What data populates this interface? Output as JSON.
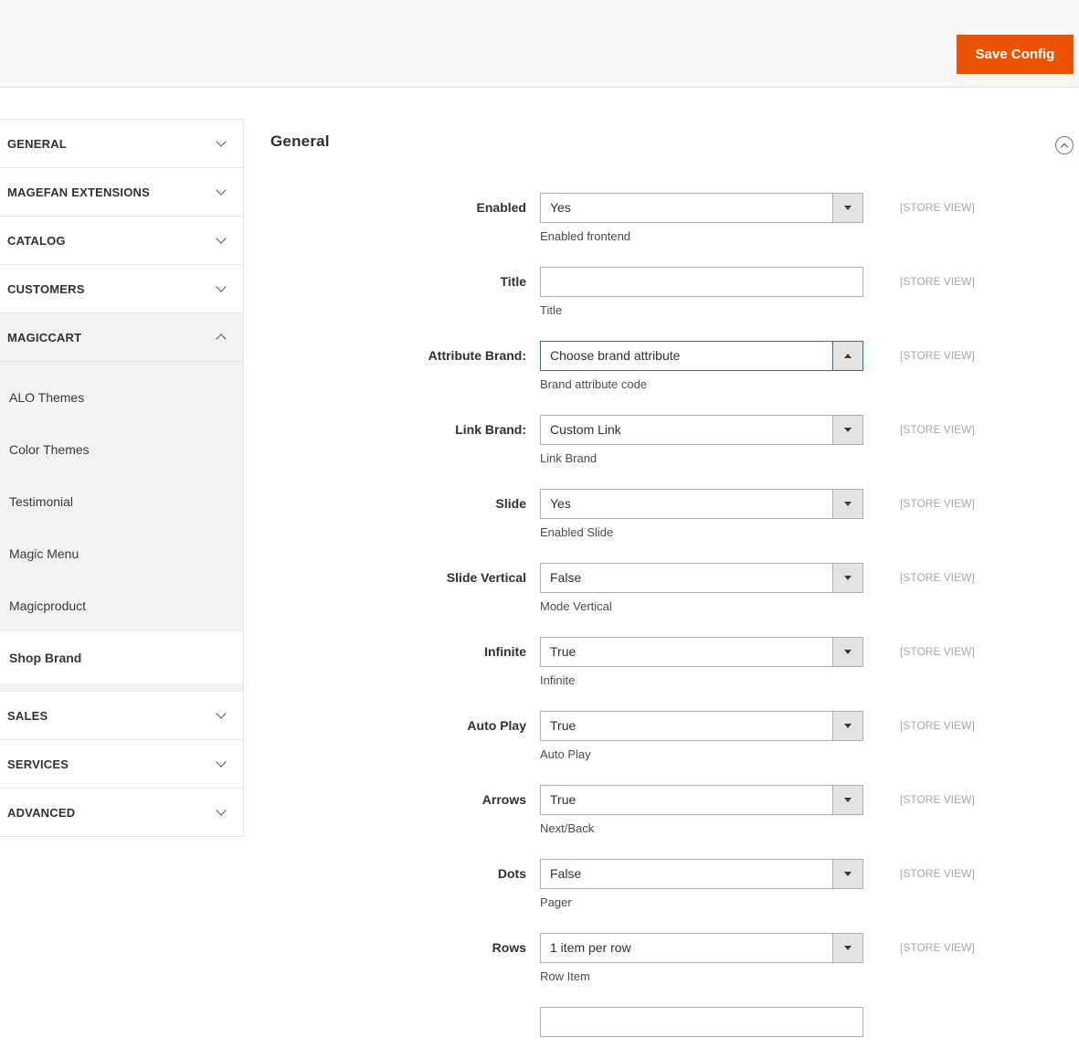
{
  "header": {
    "save_button_label": "Save Config"
  },
  "colors": {
    "accent": "#eb5202",
    "focus_border": "#007bdb",
    "panel_border": "#e3e3e3",
    "input_border": "#adadad",
    "scope_text": "#a7a7a7"
  },
  "sidebar": {
    "sections": [
      {
        "label": "GENERAL",
        "state": "collapsed"
      },
      {
        "label": "MAGEFAN EXTENSIONS",
        "state": "collapsed"
      },
      {
        "label": "CATALOG",
        "state": "collapsed"
      },
      {
        "label": "CUSTOMERS",
        "state": "collapsed"
      },
      {
        "label": "MAGICCART",
        "state": "expanded",
        "children": [
          "ALO Themes",
          "Color Themes",
          "Testimonial",
          "Magic Menu",
          "Magicproduct",
          "Shop Brand"
        ],
        "active_child": "Shop Brand"
      },
      {
        "label": "SALES",
        "state": "collapsed"
      },
      {
        "label": "SERVICES",
        "state": "collapsed"
      },
      {
        "label": "ADVANCED",
        "state": "collapsed"
      }
    ]
  },
  "main": {
    "section_title": "General",
    "collapse_icon": "chevron-up-circle-icon",
    "fields": [
      {
        "label": "Enabled",
        "control": "select",
        "value": "Yes",
        "note": "Enabled frontend",
        "scope": "[STORE VIEW]",
        "arrow": "down",
        "focused": false
      },
      {
        "label": "Title",
        "control": "text",
        "value": "",
        "note": "Title",
        "scope": "[STORE VIEW]"
      },
      {
        "label": "Attribute Brand:",
        "control": "select",
        "value": "Choose brand attribute",
        "note": "Brand attribute code",
        "scope": "[STORE VIEW]",
        "arrow": "up",
        "focused": true
      },
      {
        "label": "Link Brand:",
        "control": "select",
        "value": "Custom Link",
        "note": "Link Brand",
        "scope": "[STORE VIEW]",
        "arrow": "down",
        "focused": false
      },
      {
        "label": "Slide",
        "control": "select",
        "value": "Yes",
        "note": "Enabled Slide",
        "scope": "[STORE VIEW]",
        "arrow": "down",
        "focused": false
      },
      {
        "label": "Slide Vertical",
        "control": "select",
        "value": "False",
        "note": "Mode Vertical",
        "scope": "[STORE VIEW]",
        "arrow": "down",
        "focused": false
      },
      {
        "label": "Infinite",
        "control": "select",
        "value": "True",
        "note": "Infinite",
        "scope": "[STORE VIEW]",
        "arrow": "down",
        "focused": false
      },
      {
        "label": "Auto Play",
        "control": "select",
        "value": "True",
        "note": "Auto Play",
        "scope": "[STORE VIEW]",
        "arrow": "down",
        "focused": false
      },
      {
        "label": "Arrows",
        "control": "select",
        "value": "True",
        "note": "Next/Back",
        "scope": "[STORE VIEW]",
        "arrow": "down",
        "focused": false
      },
      {
        "label": "Dots",
        "control": "select",
        "value": "False",
        "note": "Pager",
        "scope": "[STORE VIEW]",
        "arrow": "down",
        "focused": false
      },
      {
        "label": "Rows",
        "control": "select",
        "value": "1 item per row",
        "note": "Row Item",
        "scope": "[STORE VIEW]",
        "arrow": "down",
        "focused": false
      }
    ],
    "partial_next_input": true
  }
}
